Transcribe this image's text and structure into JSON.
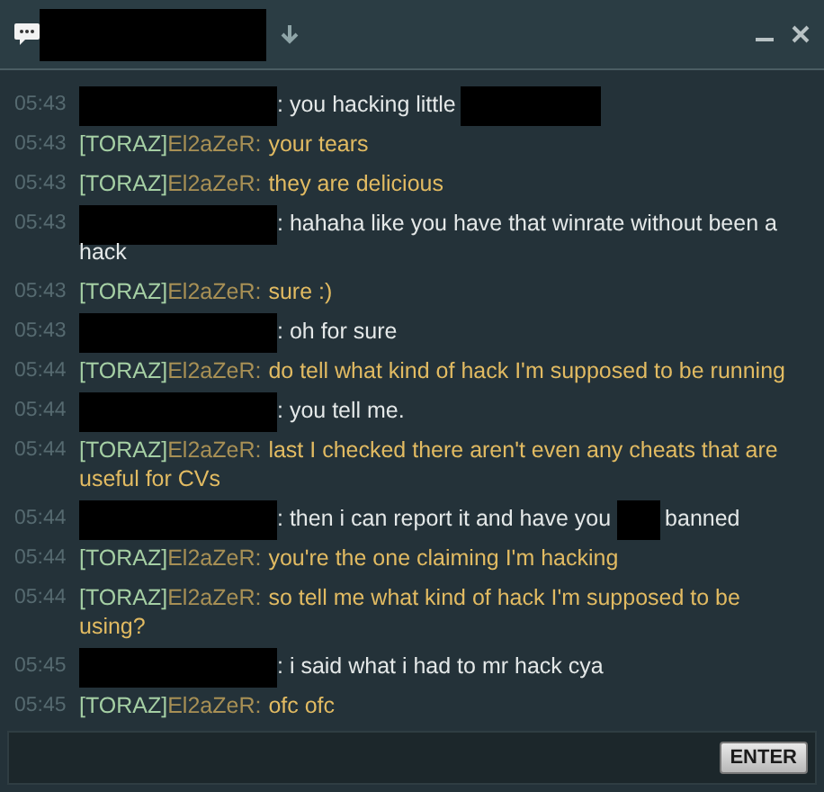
{
  "window": {
    "title_redacted": true,
    "controls": [
      {
        "kind": "minimize"
      },
      {
        "kind": "close"
      }
    ]
  },
  "messages": [
    {
      "time": "05:43",
      "sender": {
        "kind": "redacted"
      },
      "parts": [
        {
          "kind": "text",
          "text": ": you hacking little"
        },
        {
          "kind": "redaction"
        }
      ]
    },
    {
      "time": "05:43",
      "sender": {
        "kind": "named",
        "clan": "[TORAZ]",
        "name": "El2aZeR:"
      },
      "parts": [
        {
          "kind": "text",
          "text": "your tears"
        }
      ]
    },
    {
      "time": "05:43",
      "sender": {
        "kind": "named",
        "clan": "[TORAZ]",
        "name": "El2aZeR:"
      },
      "parts": [
        {
          "kind": "text",
          "text": "they are delicious"
        }
      ]
    },
    {
      "time": "05:43",
      "sender": {
        "kind": "redacted"
      },
      "parts": [
        {
          "kind": "text",
          "lines": [
            ": hahaha like you have that winrate without been a",
            "hack"
          ]
        }
      ]
    },
    {
      "time": "05:43",
      "sender": {
        "kind": "named",
        "clan": "[TORAZ]",
        "name": "El2aZeR:"
      },
      "parts": [
        {
          "kind": "text",
          "text": "sure :)"
        }
      ]
    },
    {
      "time": "05:43",
      "sender": {
        "kind": "redacted"
      },
      "parts": [
        {
          "kind": "text",
          "text": ": oh for sure"
        }
      ]
    },
    {
      "time": "05:44",
      "sender": {
        "kind": "named",
        "clan": "[TORAZ]",
        "name": "El2aZeR:"
      },
      "parts": [
        {
          "kind": "text",
          "text": "do tell what kind of hack I'm supposed to be running"
        }
      ]
    },
    {
      "time": "05:44",
      "sender": {
        "kind": "redacted"
      },
      "parts": [
        {
          "kind": "text",
          "text": ": you tell me."
        }
      ]
    },
    {
      "time": "05:44",
      "sender": {
        "kind": "named",
        "clan": "[TORAZ]",
        "name": "El2aZeR:"
      },
      "parts": [
        {
          "kind": "text",
          "lines": [
            "last I checked there aren't even any cheats that are",
            "useful for CVs"
          ]
        }
      ]
    },
    {
      "time": "05:44",
      "sender": {
        "kind": "redacted"
      },
      "parts": [
        {
          "kind": "text",
          "text": ": then i can report it and have you"
        },
        {
          "kind": "redaction"
        },
        {
          "kind": "text",
          "text": "banned"
        }
      ]
    },
    {
      "time": "05:44",
      "sender": {
        "kind": "named",
        "clan": "[TORAZ]",
        "name": "El2aZeR:"
      },
      "parts": [
        {
          "kind": "text",
          "text": "you're the one claiming I'm hacking"
        }
      ]
    },
    {
      "time": "05:44",
      "sender": {
        "kind": "named",
        "clan": "[TORAZ]",
        "name": "El2aZeR:"
      },
      "parts": [
        {
          "kind": "text",
          "lines": [
            "so tell me what kind of hack I'm supposed to be",
            "using?"
          ]
        }
      ]
    },
    {
      "time": "05:45",
      "sender": {
        "kind": "redacted"
      },
      "parts": [
        {
          "kind": "text",
          "text": ": i said what i had to mr hack cya"
        }
      ]
    },
    {
      "time": "05:45",
      "sender": {
        "kind": "named",
        "clan": "[TORAZ]",
        "name": "El2aZeR:"
      },
      "parts": [
        {
          "kind": "text",
          "text": "ofc ofc"
        }
      ]
    }
  ],
  "input": {
    "button": "ENTER"
  }
}
